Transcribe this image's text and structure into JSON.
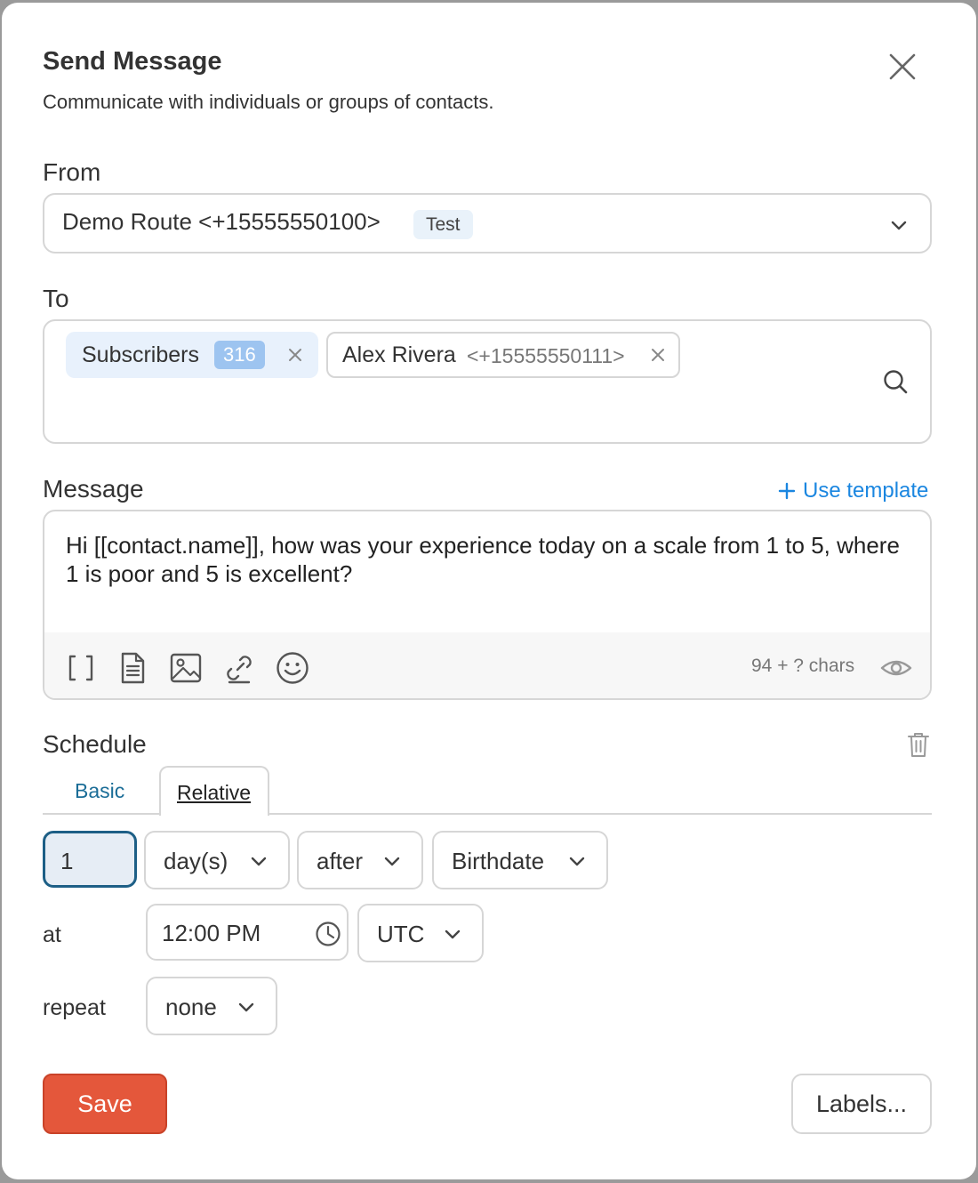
{
  "dialog": {
    "title": "Send Message",
    "subtitle": "Communicate with individuals or groups of contacts."
  },
  "from": {
    "label": "From",
    "value": "Demo Route <+15555550100>",
    "badge": "Test"
  },
  "to": {
    "label": "To",
    "recipients": [
      {
        "name": "Subscribers",
        "count": "316"
      },
      {
        "name": "Alex Rivera",
        "number": "<+15555550111>"
      }
    ]
  },
  "message": {
    "label": "Message",
    "use_template": "Use template",
    "text": "Hi [[contact.name]], how was your experience today on a scale from 1 to 5, where 1 is poor and 5 is excellent?",
    "chars": "94 + ? chars",
    "toolbar_icons": [
      "brackets-icon",
      "document-icon",
      "image-icon",
      "link-icon",
      "emoji-icon"
    ]
  },
  "schedule": {
    "label": "Schedule",
    "tabs": [
      {
        "label": "Basic",
        "active": false
      },
      {
        "label": "Relative",
        "active": true
      }
    ],
    "amount": "1",
    "unit": "day(s)",
    "direction": "after",
    "reference": "Birthdate",
    "at_label": "at",
    "time": "12:00 PM",
    "timezone": "UTC",
    "repeat_label": "repeat",
    "repeat": "none"
  },
  "actions": {
    "save": "Save",
    "labels": "Labels..."
  },
  "colors": {
    "primary": "#e4573b",
    "link": "#1a86e0",
    "focus": "#1d5f86",
    "tab_text": "#1b6d97"
  }
}
